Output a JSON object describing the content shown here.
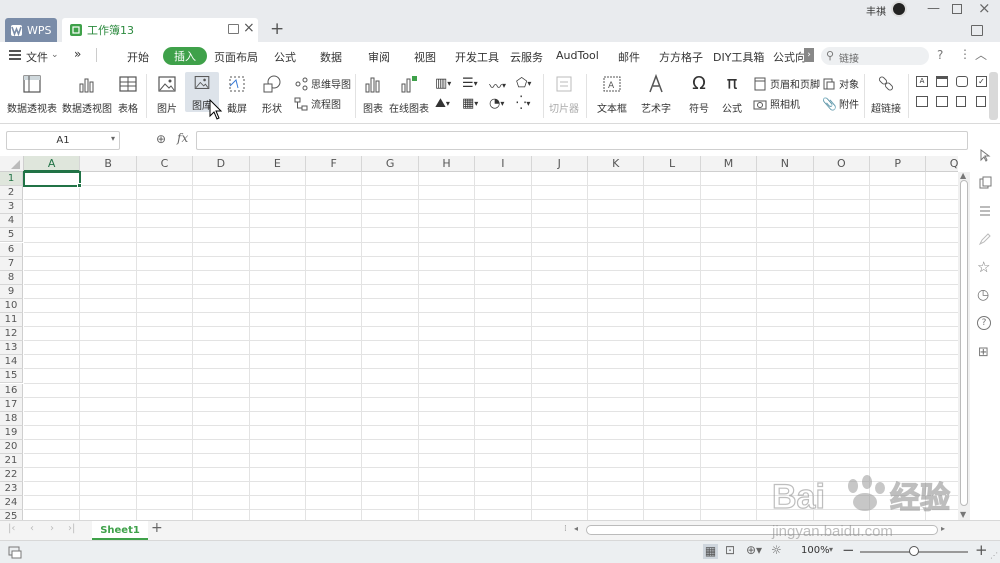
{
  "tabs": {
    "app": "WPS",
    "doc": "工作簿13"
  },
  "user": {
    "name": "丰祺"
  },
  "menus": [
    "文件",
    "»",
    "开始",
    "插入",
    "页面布局",
    "公式",
    "数据",
    "审阅",
    "视图",
    "开发工具",
    "云服务",
    "AudTool",
    "邮件",
    "方方格子",
    "DIY工具箱",
    "公式向"
  ],
  "search": {
    "placeholder": "链接"
  },
  "ribbon": {
    "pivot_table": "数据透视表",
    "pivot_chart": "数据透视图",
    "table": "表格",
    "picture": "图片",
    "gallery": "图库",
    "screenshot": "截屏",
    "shapes": "形状",
    "mindmap": "思维导图",
    "flowchart": "流程图",
    "chart": "图表",
    "online_chart": "在线图表",
    "slicer": "切片器",
    "textbox": "文本框",
    "wordart": "艺术字",
    "symbol": "符号",
    "formula": "公式",
    "header_footer": "页眉和页脚",
    "camera": "照相机",
    "object": "对象",
    "attachment": "附件",
    "hyperlink": "超链接"
  },
  "formula_bar": {
    "cell_ref": "A1",
    "fx": "fx",
    "value": ""
  },
  "columns": [
    "A",
    "B",
    "C",
    "D",
    "E",
    "F",
    "G",
    "H",
    "I",
    "J",
    "K",
    "L",
    "M",
    "N",
    "O",
    "P",
    "Q"
  ],
  "rows": [
    "1",
    "2",
    "3",
    "4",
    "5",
    "6",
    "7",
    "8",
    "9",
    "10",
    "11",
    "12",
    "13",
    "14",
    "15",
    "16",
    "17",
    "18",
    "19",
    "20",
    "21",
    "22",
    "23",
    "24",
    "25"
  ],
  "sheets": [
    "Sheet1"
  ],
  "status": {
    "zoom": "100%"
  },
  "watermark": {
    "brand": "Bai du 经验",
    "url": "jingyan.baidu.com"
  },
  "colors": {
    "accent": "#3fa14a",
    "tab_wps": "#7a8ca8",
    "title_bar": "#e9ebee"
  }
}
